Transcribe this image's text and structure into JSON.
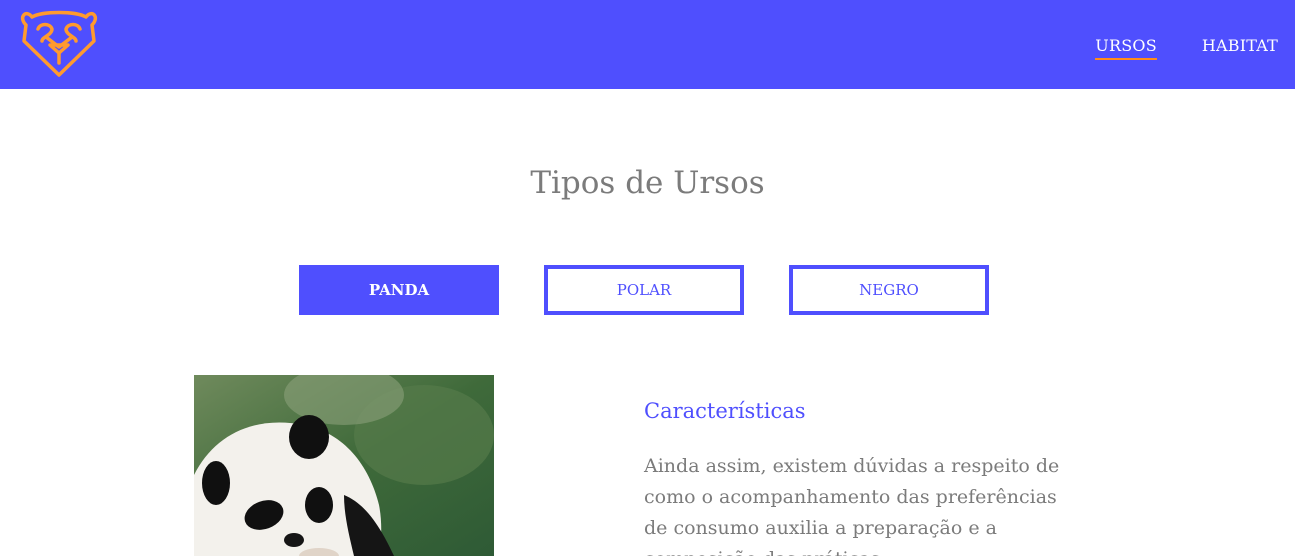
{
  "header": {
    "logo_icon": "bear-head-icon",
    "nav": [
      {
        "label": "URSOS",
        "active": true
      },
      {
        "label": "HABITAT",
        "active": false
      }
    ]
  },
  "main": {
    "title": "Tipos de Ursos",
    "tabs": [
      {
        "label": "PANDA",
        "active": true
      },
      {
        "label": "POLAR",
        "active": false
      },
      {
        "label": "NEGRO",
        "active": false
      }
    ],
    "section_title": "Características",
    "section_text": "Ainda assim, existem dúvidas a respeito de como o acompanhamento das preferências de consumo auxilia a preparação e a composição das práticas"
  },
  "colors": {
    "brand": "#4f4ffe",
    "accent": "#ff8c1a",
    "text": "#7b7b7b"
  }
}
